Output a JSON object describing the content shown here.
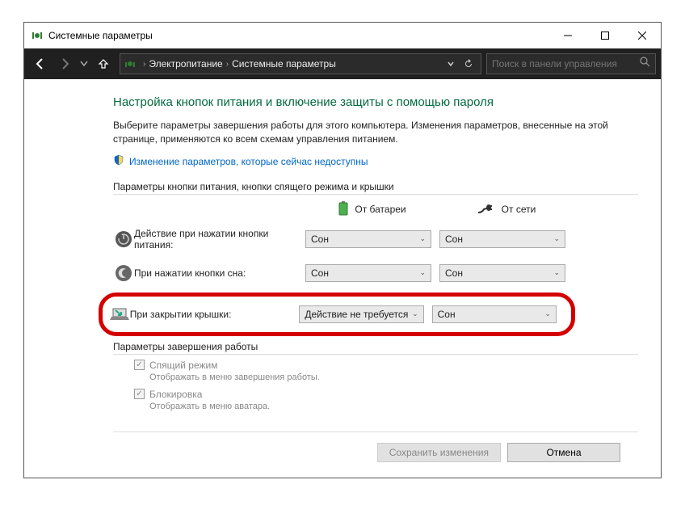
{
  "window": {
    "title": "Системные параметры"
  },
  "nav": {
    "breadcrumb": [
      "Электропитание",
      "Системные параметры"
    ],
    "search_placeholder": "Поиск в панели управления"
  },
  "content": {
    "heading": "Настройка кнопок питания и включение защиты с помощью пароля",
    "description": "Выберите параметры завершения работы для этого компьютера. Изменения параметров, внесенные на этой странице, применяются ко всем схемам управления питанием.",
    "change_link": "Изменение параметров, которые сейчас недоступны",
    "section_buttons_title": "Параметры кнопки питания, кнопки спящего режима и крышки",
    "col_battery": "От батареи",
    "col_plugged": "От сети",
    "rows": [
      {
        "label": "Действие при нажатии кнопки питания:",
        "battery": "Сон",
        "plugged": "Сон"
      },
      {
        "label": "При нажатии кнопки сна:",
        "battery": "Сон",
        "plugged": "Сон"
      },
      {
        "label": "При закрытии крышки:",
        "battery": "Действие не требуется",
        "plugged": "Сон"
      }
    ],
    "section_shutdown_title": "Параметры завершения работы",
    "checks": [
      {
        "label": "Спящий режим",
        "sub": "Отображать в меню завершения работы."
      },
      {
        "label": "Блокировка",
        "sub": "Отображать в меню аватара."
      }
    ]
  },
  "footer": {
    "save": "Сохранить изменения",
    "cancel": "Отмена"
  }
}
